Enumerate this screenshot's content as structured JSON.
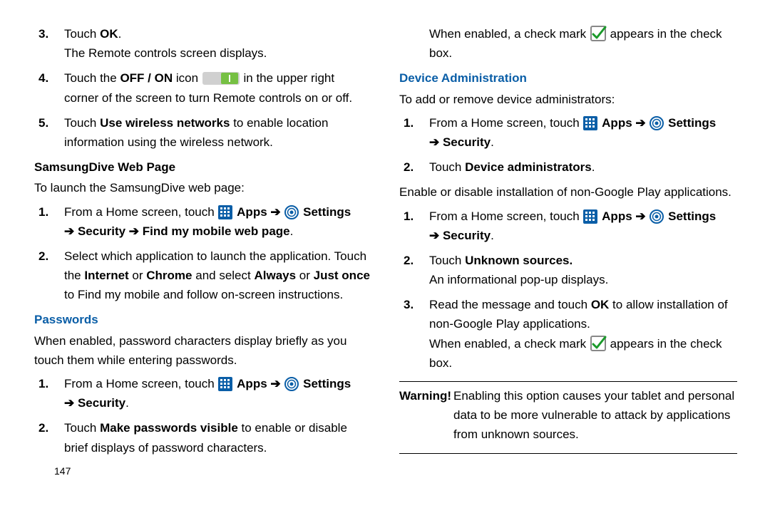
{
  "left": {
    "step3_a": "Touch ",
    "step3_b": "OK",
    "step3_c": ".",
    "step3_line2": "The Remote controls screen displays.",
    "step4_a": "Touch the ",
    "step4_b": "OFF / ON",
    "step4_c": " icon ",
    "step4_d": " in the upper right corner of the screen to turn Remote controls on or off.",
    "step5_a": "Touch ",
    "step5_b": "Use wireless networks",
    "step5_c": " to enable location information using the wireless network.",
    "sub1": "SamsungDive Web Page",
    "sub1_intro": "To launch the SamsungDive web page:",
    "sd1_a": "From a Home screen, touch ",
    "apps": "Apps",
    "arrow": "➔",
    "settings": "Settings",
    "sd1_cont_a": "➔ Security ➔ Find my mobile web page",
    "sd1_cont_b": ".",
    "sd2_a": "Select which application to launch the application. Touch the ",
    "sd2_b": "Internet",
    "sd2_c": " or ",
    "sd2_d": "Chrome ",
    "sd2_e": " and select ",
    "sd2_f": "Always",
    "sd2_g": " or ",
    "sd2_h": "Just once",
    "sd2_i": " to Find my mobile and follow on-screen instructions.",
    "pw_heading": "Passwords",
    "pw_intro": "When enabled, password characters display briefly as you touch them while entering passwords.",
    "pw1_a": "From a Home screen, touch ",
    "pw1_cont_a": "➔ Security",
    "pw1_cont_b": ".",
    "pw2_a": "Touch ",
    "pw2_b": "Make passwords visible",
    "pw2_c": " to enable or disable brief displays of password characters.",
    "page_num": "147"
  },
  "right": {
    "top_a": "When enabled, a check mark ",
    "top_b": " appears in the check box.",
    "da_heading": "Device Administration",
    "da_intro": "To add or remove device administrators:",
    "da1_a": "From a Home screen, touch ",
    "da1_cont_a": "➔ Security",
    "da1_cont_b": ".",
    "da2_a": "Touch ",
    "da2_b": "Device administrators",
    "da2_c": ".",
    "ng_intro": "Enable or disable installation of non-Google Play applications.",
    "ng1_a": "From a Home screen, touch ",
    "ng1_cont_a": "➔ Security",
    "ng1_cont_b": ".",
    "ng2_a": "Touch ",
    "ng2_b": "Unknown sources.",
    "ng2_line2": "An informational pop-up displays.",
    "ng3_a": "Read the message and touch ",
    "ng3_b": "OK",
    "ng3_c": " to allow installation of non-Google Play applications.",
    "ng3_line2_a": "When enabled, a check mark ",
    "ng3_line2_b": " appears in the check box.",
    "warn_label": "Warning!",
    "warn_text": " Enabling this option causes your tablet and personal data to be more vulnerable to attack by applications from unknown sources."
  }
}
